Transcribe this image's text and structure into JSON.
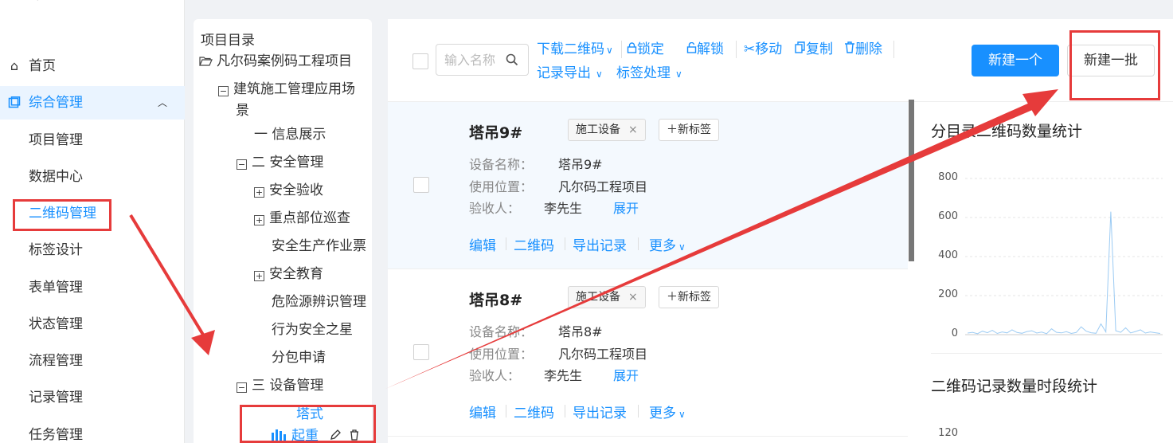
{
  "nav": {
    "items": [
      {
        "label": "首页",
        "icon": "home-icon"
      },
      {
        "label": "综合管理",
        "icon": "list-icon"
      },
      {
        "label": "项目管理"
      },
      {
        "label": "数据中心"
      },
      {
        "label": "二维码管理"
      },
      {
        "label": "标签设计"
      },
      {
        "label": "表单管理"
      },
      {
        "label": "状态管理"
      },
      {
        "label": "流程管理"
      },
      {
        "label": "记录管理"
      },
      {
        "label": "任务管理"
      }
    ],
    "active_group": "综合管理"
  },
  "tree": {
    "title": "项目目录",
    "nodes": [
      {
        "label": "凡尔码案例码工程项目"
      },
      {
        "label": "建筑施工管理应用场"
      },
      {
        "label": "景"
      },
      {
        "label": "一 信息展示"
      },
      {
        "label": "二 安全管理"
      },
      {
        "label": "安全验收"
      },
      {
        "label": "重点部位巡查"
      },
      {
        "label": "安全生产作业票"
      },
      {
        "label": "安全教育"
      },
      {
        "label": "危险源辨识管理"
      },
      {
        "label": "行为安全之星"
      },
      {
        "label": "分包申请"
      },
      {
        "label": "三 设备管理"
      },
      {
        "label": "塔式"
      },
      {
        "label": "起重"
      }
    ]
  },
  "toolbar": {
    "search_placeholder": "输入名称",
    "download_qr": "下载二维码",
    "lock": "锁定",
    "unlock": "解锁",
    "move": "移动",
    "copy": "复制",
    "delete": "删除",
    "export_records": "记录导出",
    "tag_process": "标签处理",
    "new_one": "新建一个",
    "new_batch": "新建一批"
  },
  "records": [
    {
      "title": "塔吊9#",
      "tag": "施工设备",
      "add_tag": "新标签",
      "fields": [
        {
          "label": "设备名称：",
          "value": "塔吊9#"
        },
        {
          "label": "使用位置：",
          "value": "凡尔码工程项目"
        },
        {
          "label": "验收人：",
          "value": "李先生"
        }
      ],
      "expand": "展开",
      "actions": [
        "编辑",
        "二维码",
        "导出记录",
        "更多"
      ]
    },
    {
      "title": "塔吊8#",
      "tag": "施工设备",
      "add_tag": "新标签",
      "fields": [
        {
          "label": "设备名称：",
          "value": "塔吊8#"
        },
        {
          "label": "使用位置：",
          "value": "凡尔码工程项目"
        },
        {
          "label": "验收人：",
          "value": "李先生"
        }
      ],
      "expand": "展开",
      "actions": [
        "编辑",
        "二维码",
        "导出记录",
        "更多"
      ]
    }
  ],
  "charts": {
    "chart1_title": "分目录二维码数量统计",
    "chart2_title": "二维码记录数量时段统计",
    "chart2_first_tick": "120"
  },
  "chart_data": {
    "type": "line",
    "title": "分目录二维码数量统计",
    "ylim": [
      0,
      800
    ],
    "yticks": [
      0,
      200,
      400,
      600,
      800
    ],
    "grid": true,
    "series": [
      {
        "values": [
          8,
          12,
          5,
          18,
          10,
          22,
          6,
          14,
          9,
          25,
          11,
          7,
          16,
          20,
          8,
          13,
          5,
          30,
          12,
          9,
          15,
          6,
          11,
          40,
          18,
          10,
          7,
          55,
          14,
          630,
          20,
          12,
          35,
          9,
          16,
          25,
          8,
          14,
          10,
          6
        ]
      }
    ]
  },
  "colors": {
    "accent": "#1890ff",
    "annotation": "#e63b3b"
  }
}
